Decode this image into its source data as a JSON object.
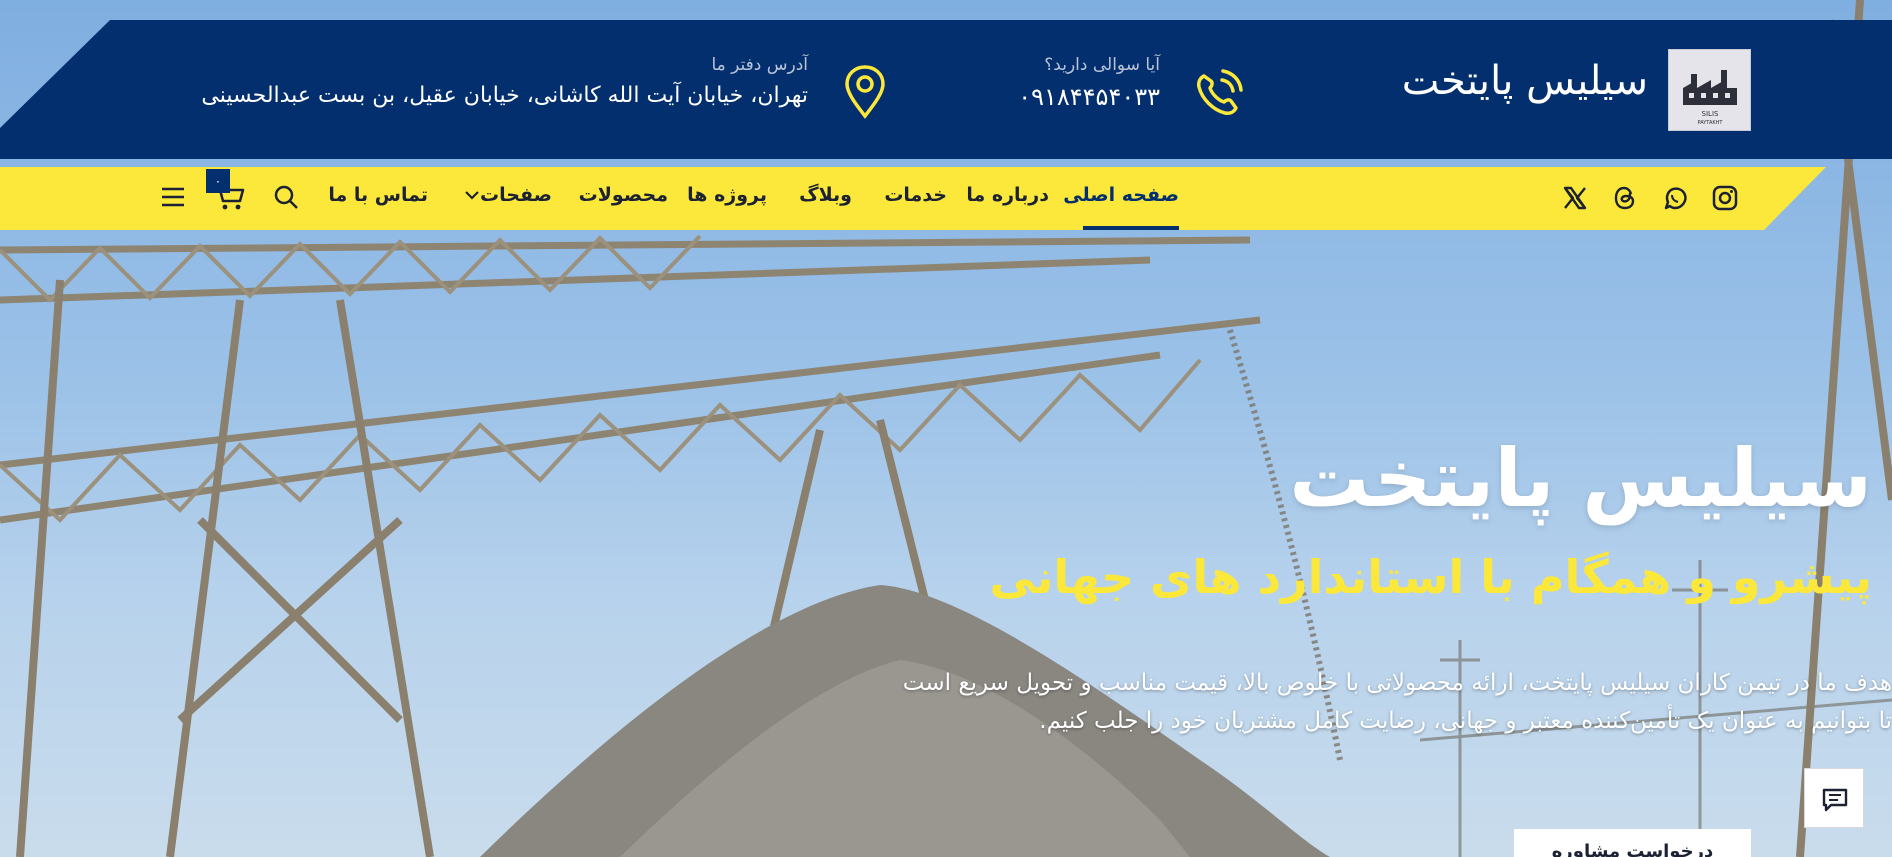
{
  "header": {
    "brand_name": "سیلیس پایتخت",
    "logo_text": "SILIS PAYTAKHT",
    "phone_label": "آیا سوالی دارید؟",
    "phone_number": "۰۹۱۸۴۴۵۴۰۳۳",
    "address_label": "آدرس دفتر ما",
    "address_value": "تهران، خیابان آیت الله کاشانی، خیابان عقیل، بن بست عبدالحسینی"
  },
  "nav": {
    "items": [
      {
        "label": "صفحه اصلی",
        "active": true
      },
      {
        "label": "درباره ما"
      },
      {
        "label": "خدمات"
      },
      {
        "label": "وبلاگ"
      },
      {
        "label": "پروژه ها"
      },
      {
        "label": "محصولات"
      },
      {
        "label": "صفحات"
      },
      {
        "label": "تماس با ما"
      }
    ],
    "cart_count": "۰",
    "social_icons": [
      "instagram-icon",
      "whatsapp-icon",
      "threads-icon",
      "x-icon"
    ],
    "tool_icons": [
      "search-icon",
      "cart-icon",
      "menu-icon"
    ]
  },
  "hero": {
    "title": "سیلیس پایتخت",
    "subtitle": "پیشرو و همگام با استاندارد های جهانی",
    "desc_line1": "هدف ما در تیمن کاران سیلیس پایتخت، ارائه محصولاتی با خلوص بالا، قیمت مناسب و تحویل سریع است",
    "desc_line2": "تا بتوانیم به عنوان یک تأمین‌کننده معتبر و جهانی، رضایت کامل مشتریان خود را جلب کنیم.",
    "cta_label": "درخواست مشاوره"
  },
  "colors": {
    "navy": "#042f6e",
    "yellow": "#fce83a",
    "white": "#ffffff"
  }
}
